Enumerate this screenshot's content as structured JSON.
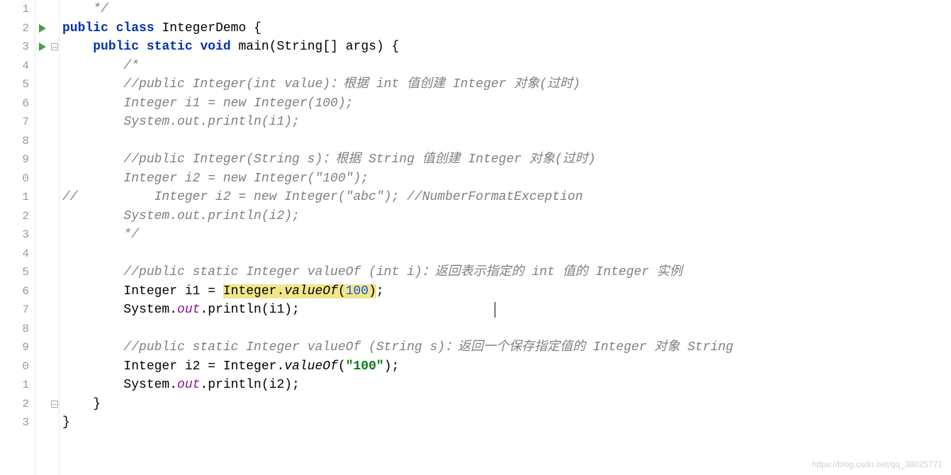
{
  "watermark": "https://blog.csdn.net/qq_38025771",
  "gutter": {
    "lines": [
      "1",
      "2",
      "3",
      "4",
      "5",
      "6",
      "7",
      "8",
      "9",
      "0",
      "1",
      "2",
      "3",
      "4",
      "5",
      "6",
      "7",
      "8",
      "9",
      "0",
      "1",
      "2",
      "3"
    ],
    "run_markers": [
      2,
      3
    ],
    "fold_markers": [
      3,
      22
    ]
  },
  "code": {
    "line1": "    */",
    "line2_kw1": "public",
    "line2_kw2": "class",
    "line2_name": "IntegerDemo",
    "line2_brace": " {",
    "line3_kw1": "public",
    "line3_kw2": "static",
    "line3_kw3": "void",
    "line3_method": "main",
    "line3_params": "(String[] args) {",
    "line4": "        /*",
    "line5": "        //public Integer(int value)：根据 int 值创建 Integer 对象(过时)",
    "line6": "        Integer i1 = new Integer(100);",
    "line7": "        System.out.println(i1);",
    "line8": "",
    "line9": "        //public Integer(String s)：根据 String 值创建 Integer 对象(过时)",
    "line10": "        Integer i2 = new Integer(\"100\");",
    "line11_pre": "//",
    "line11": "          Integer i2 = new Integer(\"abc\"); //NumberFormatException",
    "line12": "        System.out.println(i2);",
    "line13": "        */",
    "line14": "",
    "line15": "        //public static Integer valueOf (int i)：返回表示指定的 int 值的 Integer 实例",
    "line16_pre": "        Integer i1 = ",
    "line16_hl1": "Integer.",
    "line16_hl2": "valueOf",
    "line16_hl3": "(",
    "line16_hl4": "100",
    "line16_hl5": ")",
    "line16_post": ";",
    "line17_pre": "        System.",
    "line17_out": "out",
    "line17_post": ".println(i1);",
    "line18": "",
    "line19": "        //public static Integer valueOf (String s)：返回一个保存指定值的 Integer 对象 String",
    "line20_pre": "        Integer i2 = Integer.",
    "line20_method": "valueOf",
    "line20_paren": "(",
    "line20_str": "\"100\"",
    "line20_post": ");",
    "line21_pre": "        System.",
    "line21_out": "out",
    "line21_post": ".println(i2);",
    "line22": "    }",
    "line23": "}"
  }
}
